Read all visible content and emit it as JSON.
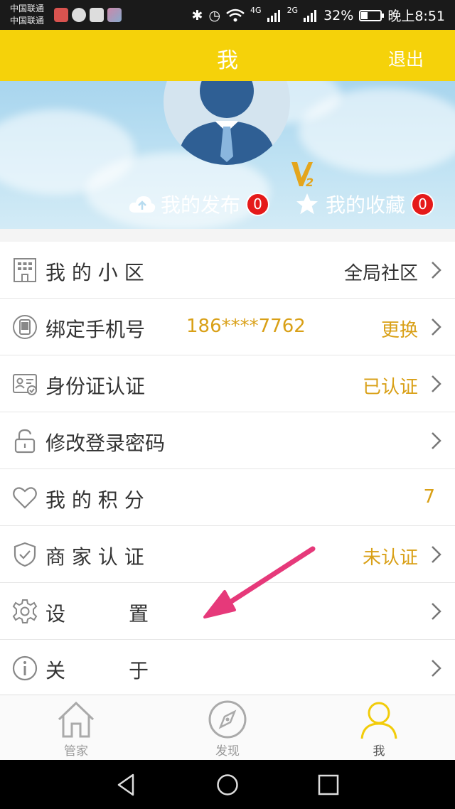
{
  "status_bar": {
    "carrier1": "中国联通",
    "carrier2": "中国联通",
    "network1": "4G",
    "network2": "2G",
    "battery_pct": "32%",
    "battery_level": 0.32,
    "time": "晚上8:51"
  },
  "header": {
    "title": "我",
    "logout_label": "退出"
  },
  "profile": {
    "badge": "V2",
    "posts_label": "我的发布",
    "posts_count": "0",
    "favs_label": "我的收藏",
    "favs_count": "0"
  },
  "menu": [
    {
      "icon": "building-icon",
      "label": "我 的 小 区",
      "value": "全局社区"
    },
    {
      "icon": "phone-icon",
      "label": "绑定手机号",
      "sub": "186****7762",
      "value": "更换"
    },
    {
      "icon": "id-card-icon",
      "label": "身份证认证",
      "value": "已认证"
    },
    {
      "icon": "lock-icon",
      "label": "修改登录密码"
    },
    {
      "icon": "heart-icon",
      "label": "我 的 积 分",
      "value": "7"
    },
    {
      "icon": "shield-icon",
      "label": "商 家 认 证",
      "value": "未认证"
    },
    {
      "icon": "gear-icon",
      "label": "设          置"
    },
    {
      "icon": "info-icon",
      "label": "关          于"
    }
  ],
  "tabs": [
    {
      "icon": "home-icon",
      "label": "管家"
    },
    {
      "icon": "compass-icon",
      "label": "发现"
    },
    {
      "icon": "user-icon",
      "label": "我",
      "active": true
    }
  ],
  "colors": {
    "brand_yellow": "#f5d20a",
    "gold_text": "#d9a017",
    "badge_red": "#e51a1a",
    "arrow_pink": "#e6397a"
  }
}
